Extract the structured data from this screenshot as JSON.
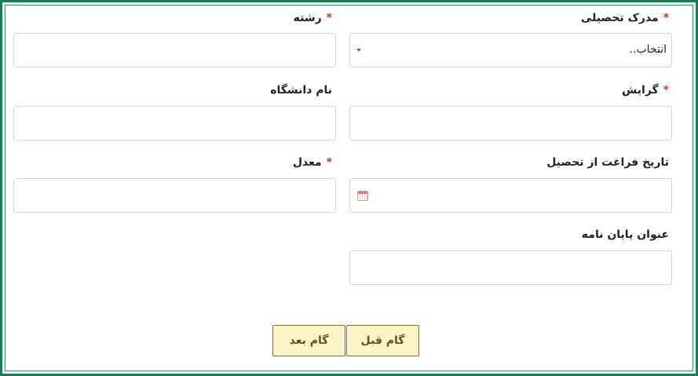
{
  "form": {
    "required_mark": "*",
    "degree": {
      "label": "مدرک تحصیلی",
      "value": "انتخاب.."
    },
    "major": {
      "label": "رشته",
      "value": ""
    },
    "orientation": {
      "label": "گرایش",
      "value": ""
    },
    "university": {
      "label": "نام دانشگاه",
      "value": ""
    },
    "graduation_date": {
      "label": "تاریخ فراغت از تحصیل",
      "value": ""
    },
    "gpa": {
      "label": "معدل",
      "value": ""
    },
    "thesis_title": {
      "label": "عنوان پایان نامه",
      "value": ""
    }
  },
  "buttons": {
    "previous": "گام قبل",
    "next": "گام بعد"
  },
  "colors": {
    "frame": "#1e7a52",
    "required": "#c0392b",
    "button_bg": "#fdf3c8",
    "button_border": "#8a6a2a"
  },
  "icons": {
    "select_caret": "chevron-down-icon",
    "date_picker": "calendar-icon"
  }
}
